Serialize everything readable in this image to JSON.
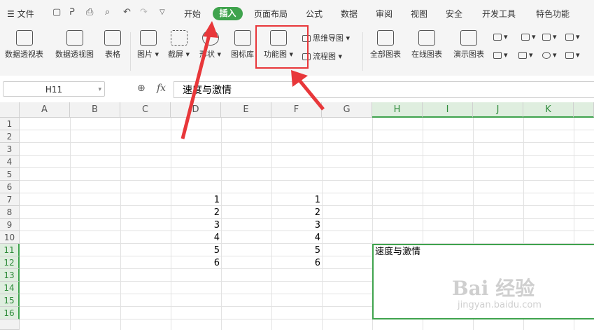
{
  "menubar": {
    "file_label": "文件",
    "tabs": [
      "开始",
      "插入",
      "页面布局",
      "公式",
      "数据",
      "审阅",
      "视图",
      "安全",
      "开发工具",
      "特色功能"
    ],
    "active_tab": "插入"
  },
  "ribbon": {
    "pivot_table": "数据透视表",
    "pivot_chart": "数据透视图",
    "table": "表格",
    "picture": "图片",
    "screenshot": "截屏",
    "shapes": "形状",
    "icon_library": "图标库",
    "function_chart": "功能图",
    "mind_map": "思维导图",
    "flowchart": "流程图",
    "all_charts": "全部图表",
    "online_charts": "在线图表",
    "demo_charts": "演示图表"
  },
  "formula_bar": {
    "name_box": "H11",
    "fx_label": "fx",
    "formula_value": "速度与激情"
  },
  "sheet": {
    "columns": [
      "A",
      "B",
      "C",
      "D",
      "E",
      "F",
      "G",
      "H",
      "I",
      "J",
      "K"
    ],
    "rows": [
      "1",
      "2",
      "3",
      "4",
      "5",
      "6",
      "7",
      "8",
      "9",
      "10",
      "11",
      "12",
      "13",
      "14",
      "15",
      "16"
    ],
    "col_d_values": [
      "1",
      "2",
      "3",
      "4",
      "5",
      "6"
    ],
    "col_f_values": [
      "1",
      "2",
      "3",
      "4",
      "5",
      "6"
    ],
    "h11_text": "速度与激情"
  },
  "watermark": {
    "brand": "Bai 经验",
    "url": "jingyan.baidu.com"
  },
  "colors": {
    "accent_green": "#3fa34d",
    "annotation_red": "#e8373a"
  }
}
